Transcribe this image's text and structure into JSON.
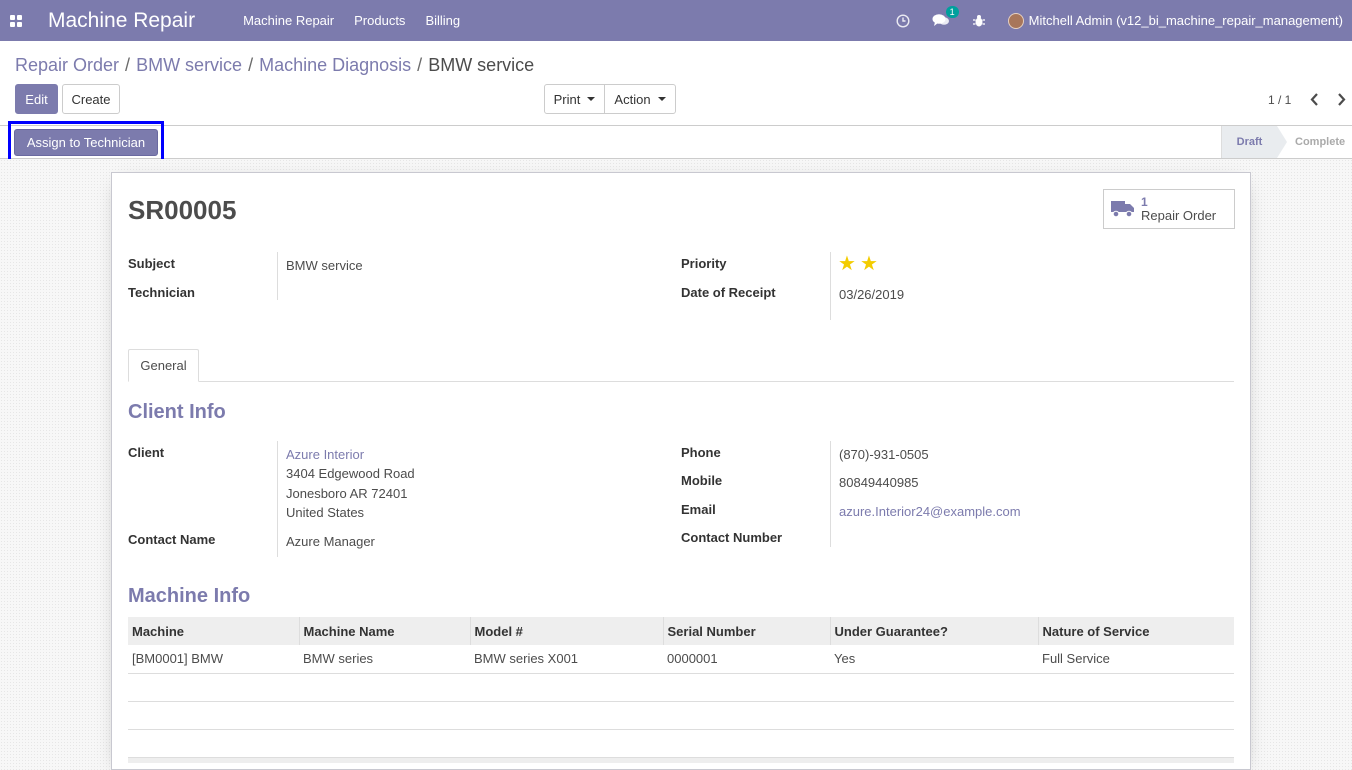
{
  "navbar": {
    "brand": "Machine Repair",
    "menu": [
      "Machine Repair",
      "Products",
      "Billing"
    ],
    "message_count": "1",
    "user": "Mitchell Admin (v12_bi_machine_repair_management)"
  },
  "breadcrumb": {
    "items": [
      "Repair Order",
      "BMW service",
      "Machine Diagnosis"
    ],
    "active": "BMW service",
    "separator": "/"
  },
  "toolbar": {
    "edit_label": "Edit",
    "create_label": "Create",
    "print_label": "Print",
    "action_label": "Action",
    "pager": "1 / 1"
  },
  "statusbar": {
    "assign_label": "Assign to Technician",
    "stages": [
      "Draft",
      "Complete"
    ],
    "active_stage": "Draft"
  },
  "form": {
    "reference": "SR00005",
    "smart_button": {
      "count": "1",
      "label": "Repair Order"
    },
    "subject_label": "Subject",
    "subject": "BMW service",
    "technician_label": "Technician",
    "technician": "",
    "priority_label": "Priority",
    "priority_stars": 2,
    "receipt_label": "Date of Receipt",
    "receipt_date": "03/26/2019",
    "tab_general": "General"
  },
  "client_info": {
    "title": "Client Info",
    "client_label": "Client",
    "client_name": "Azure Interior",
    "address_line1": "3404 Edgewood Road",
    "address_line2": "Jonesboro AR 72401",
    "address_line3": "United States",
    "contact_name_label": "Contact Name",
    "contact_name": "Azure Manager",
    "phone_label": "Phone",
    "phone": "(870)-931-0505",
    "mobile_label": "Mobile",
    "mobile": "80849440985",
    "email_label": "Email",
    "email": "azure.Interior24@example.com",
    "contact_number_label": "Contact Number",
    "contact_number": ""
  },
  "machine_info": {
    "title": "Machine Info",
    "columns": [
      "Machine",
      "Machine Name",
      "Model #",
      "Serial Number",
      "Under Guarantee?",
      "Nature of Service"
    ],
    "rows": [
      [
        "[BM0001] BMW",
        "BMW series",
        "BMW series X001",
        "0000001",
        "Yes",
        "Full Service"
      ]
    ]
  },
  "colors": {
    "brand": "#7c7bad",
    "star": "#f3cc00",
    "highlight_border": "#0000ff"
  }
}
